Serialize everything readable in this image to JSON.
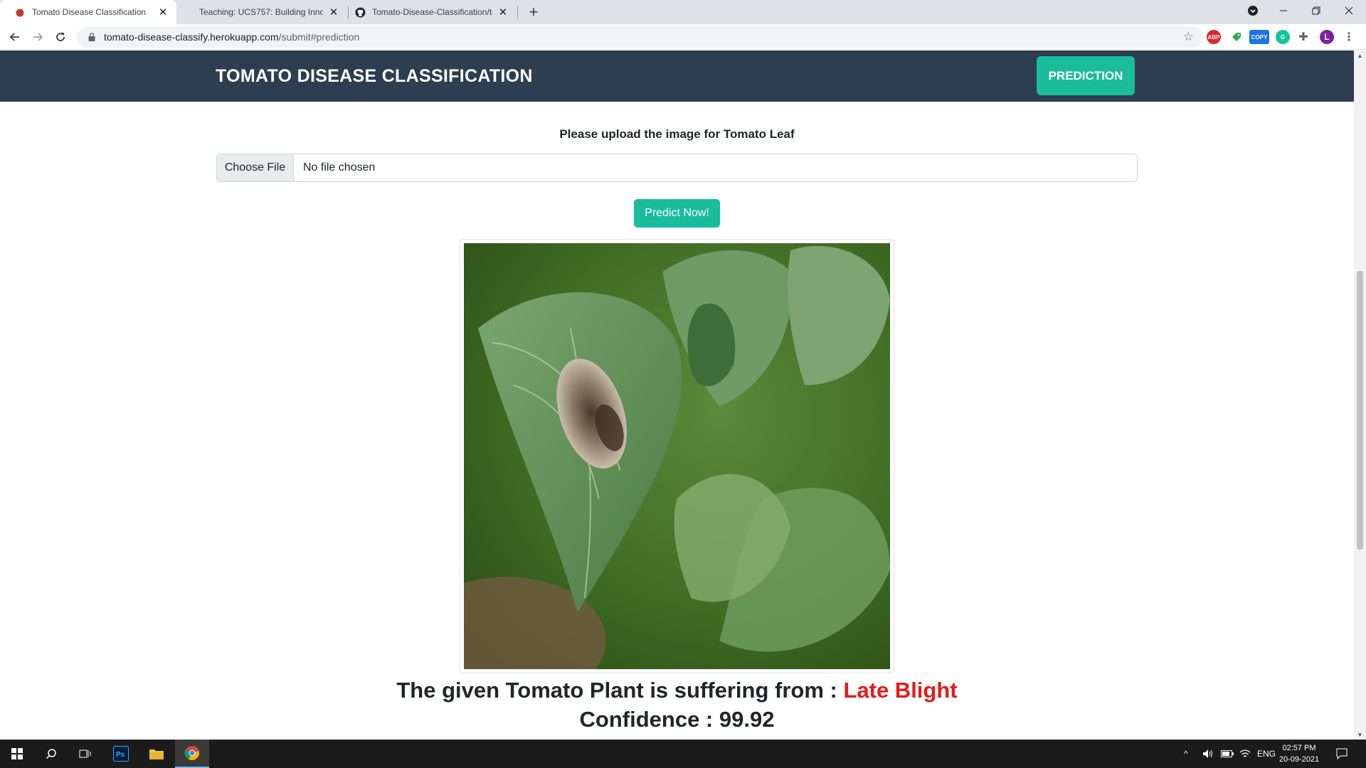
{
  "browser": {
    "tabs": [
      {
        "title": "Tomato Disease Classification",
        "favicon": "tomato-icon",
        "active": true
      },
      {
        "title": "Teaching: UCS757: Building Innov",
        "favicon": "none",
        "active": false
      },
      {
        "title": "Tomato-Disease-Classification/tr",
        "favicon": "github-icon",
        "active": false
      }
    ],
    "new_tab": "+",
    "url_host": "tomato-disease-classify.herokuapp.com",
    "url_path": "/submit#prediction",
    "extensions": {
      "abp": "ABP",
      "copy": "COPY",
      "profile": "L"
    }
  },
  "site": {
    "brand": "TOMATO DISEASE CLASSIFICATION",
    "nav_button": "PREDICTION"
  },
  "upload": {
    "label": "Please upload the image for Tomato Leaf",
    "choose_file": "Choose File",
    "file_status": "No file chosen"
  },
  "predict_button": "Predict Now!",
  "result": {
    "prefix": "The given Tomato Plant is suffering from : ",
    "disease": "Late Blight",
    "confidence": "Confidence : 99.92"
  },
  "taskbar": {
    "time": "02:57 PM",
    "date": "20-09-2021",
    "language": "ENG"
  },
  "colors": {
    "navbar": "#2c3e50",
    "accent": "#1abc9c",
    "disease": "#e41b17"
  }
}
